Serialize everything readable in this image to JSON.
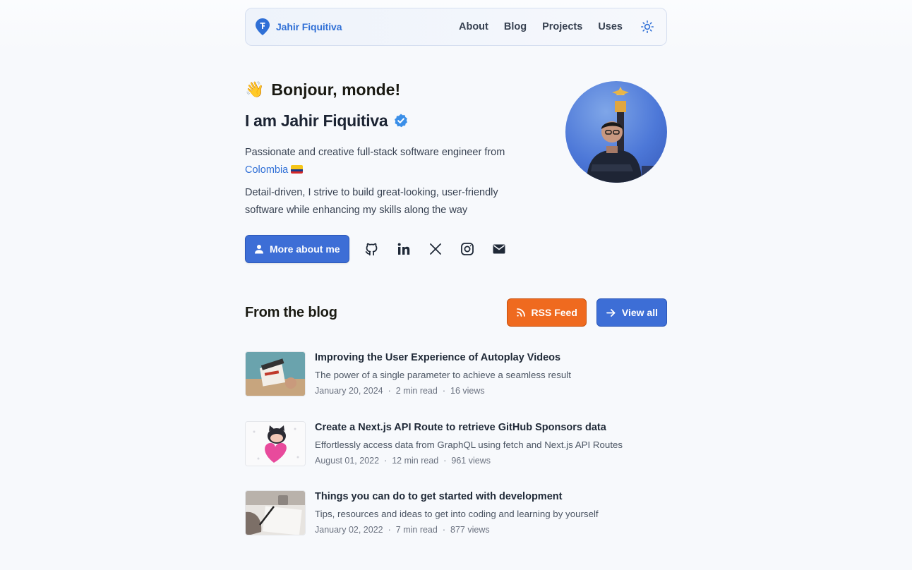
{
  "header": {
    "site_name": "Jahir Fiquitiva",
    "nav": [
      "About",
      "Blog",
      "Projects",
      "Uses"
    ],
    "theme_icon": "sun-icon"
  },
  "hero": {
    "wave_emoji": "👋",
    "greeting": "Bonjour, monde!",
    "name": "I am Jahir Fiquitiva",
    "verified_icon": "verified-badge-icon",
    "bio_prefix": "Passionate and creative full-stack software engineer from ",
    "bio_link": "Colombia",
    "bio2": "Detail-driven, I strive to build great-looking, user-friendly software while enhancing my skills along the way",
    "more_button": "More about me",
    "social_icons": [
      "github-icon",
      "linkedin-icon",
      "x-icon",
      "instagram-icon",
      "email-icon"
    ]
  },
  "blog": {
    "title": "From the blog",
    "rss_button": "RSS Feed",
    "view_all_button": "View all",
    "posts": [
      {
        "title": "Improving the User Experience of Autoplay Videos",
        "description": "The power of a single parameter to achieve a seamless result",
        "date": "January 20, 2024",
        "read_time": "2 min read",
        "views": "16 views"
      },
      {
        "title": "Create a Next.js API Route to retrieve GitHub Sponsors data",
        "description": "Effortlessly access data from GraphQL using fetch and Next.js API Routes",
        "date": "August 01, 2022",
        "read_time": "12 min read",
        "views": "961 views"
      },
      {
        "title": "Things you can do to get started with development",
        "description": "Tips, resources and ideas to get into coding and learning by yourself",
        "date": "January 02, 2022",
        "read_time": "7 min read",
        "views": "877 views"
      }
    ]
  },
  "colors": {
    "accent": "#3d6ed6",
    "rss": "#ef6a1f",
    "link": "#2f6fd6"
  }
}
